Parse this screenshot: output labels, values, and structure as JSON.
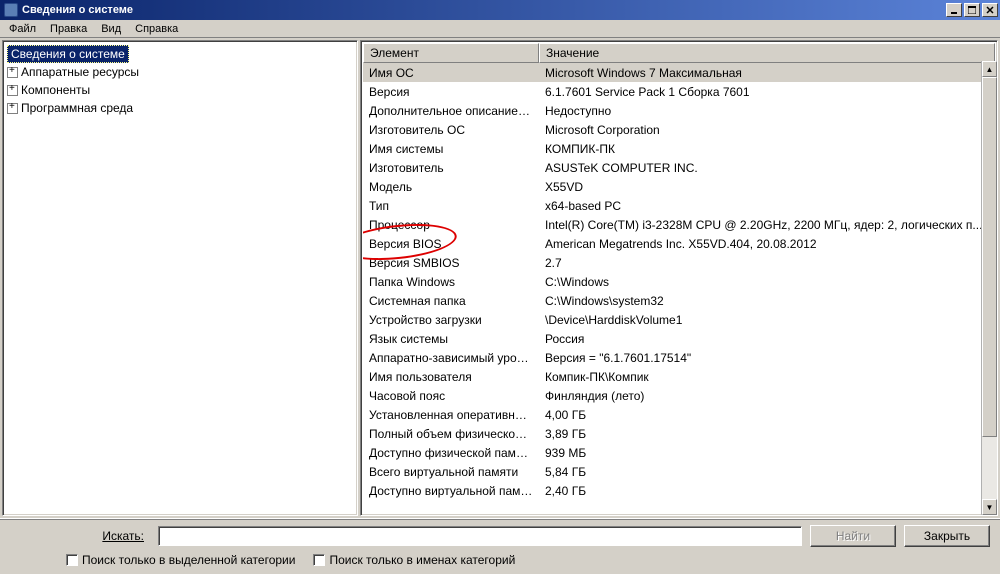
{
  "window": {
    "title": "Сведения о системе"
  },
  "menu": {
    "file": "Файл",
    "edit": "Правка",
    "view": "Вид",
    "help": "Справка"
  },
  "tree": {
    "root": "Сведения о системе",
    "items": [
      "Аппаратные ресурсы",
      "Компоненты",
      "Программная среда"
    ]
  },
  "columns": {
    "element": "Элемент",
    "value": "Значение"
  },
  "rows": [
    {
      "el": "Имя ОС",
      "val": "Microsoft Windows 7 Максимальная",
      "sel": true
    },
    {
      "el": "Версия",
      "val": "6.1.7601 Service Pack 1 Сборка 7601"
    },
    {
      "el": "Дополнительное описание ОС",
      "val": "Недоступно"
    },
    {
      "el": "Изготовитель ОС",
      "val": "Microsoft Corporation"
    },
    {
      "el": "Имя системы",
      "val": "КОМПИК-ПК"
    },
    {
      "el": "Изготовитель",
      "val": "ASUSTeK COMPUTER INC."
    },
    {
      "el": "Модель",
      "val": "X55VD"
    },
    {
      "el": "Тип",
      "val": "x64-based PC"
    },
    {
      "el": "Процессор",
      "val": "Intel(R) Core(TM) i3-2328M CPU @ 2.20GHz, 2200 МГц, ядер: 2, логических п..."
    },
    {
      "el": "Версия BIOS",
      "val": "American Megatrends Inc. X55VD.404, 20.08.2012"
    },
    {
      "el": "Версия SMBIOS",
      "val": "2.7"
    },
    {
      "el": "Папка Windows",
      "val": "C:\\Windows"
    },
    {
      "el": "Системная папка",
      "val": "C:\\Windows\\system32"
    },
    {
      "el": "Устройство загрузки",
      "val": "\\Device\\HarddiskVolume1"
    },
    {
      "el": "Язык системы",
      "val": "Россия"
    },
    {
      "el": "Аппаратно-зависимый уровен...",
      "val": "Версия = \"6.1.7601.17514\""
    },
    {
      "el": "Имя пользователя",
      "val": "Компик-ПК\\Компик"
    },
    {
      "el": "Часовой пояс",
      "val": "Финляндия (лето)"
    },
    {
      "el": "Установленная оперативная п...",
      "val": "4,00 ГБ"
    },
    {
      "el": "Полный объем физической па...",
      "val": "3,89 ГБ"
    },
    {
      "el": "Доступно физической памяти",
      "val": "939 МБ"
    },
    {
      "el": "Всего виртуальной памяти",
      "val": "5,84 ГБ"
    },
    {
      "el": "Доступно виртуальной памяти",
      "val": "2,40 ГБ"
    }
  ],
  "search": {
    "label": "Искать:",
    "find": "Найти",
    "close": "Закрыть",
    "chk1": "Поиск только в выделенной категории",
    "chk2": "Поиск только в именах категорий"
  }
}
